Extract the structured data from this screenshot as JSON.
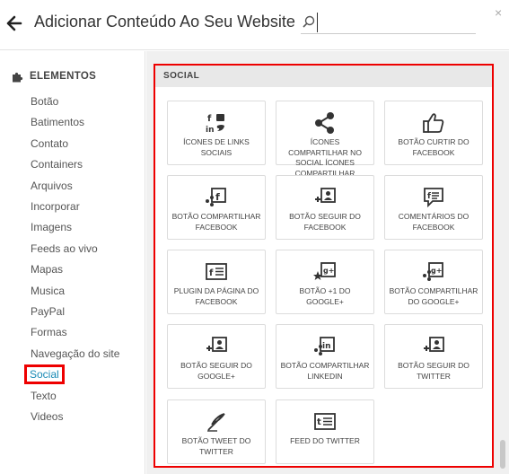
{
  "header": {
    "title": "Adicionar Conteúdo Ao Seu Website",
    "search_placeholder": "",
    "close_glyph": "×"
  },
  "sidebar": {
    "heading": "ELEMENTOS",
    "items": [
      {
        "label": "Botão"
      },
      {
        "label": "Batimentos"
      },
      {
        "label": "Contato"
      },
      {
        "label": "Containers"
      },
      {
        "label": "Arquivos"
      },
      {
        "label": "Incorporar"
      },
      {
        "label": "Imagens"
      },
      {
        "label": "Feeds ao vivo"
      },
      {
        "label": "Mapas"
      },
      {
        "label": "Musica"
      },
      {
        "label": "PayPal"
      },
      {
        "label": "Formas"
      },
      {
        "label": "Navegação do site"
      },
      {
        "label": "Social",
        "active": true
      },
      {
        "label": "Texto"
      },
      {
        "label": "Videos"
      }
    ]
  },
  "section": {
    "title": "SOCIAL"
  },
  "cards": [
    {
      "icon": "social-links-icon",
      "label": "ÍCONES DE LINKS SOCIAIS"
    },
    {
      "icon": "share-icon",
      "label": "ÍCONES COMPARTILHAR NO SOCIAL ÍCONES COMPARTILHAR SOCIAL"
    },
    {
      "icon": "thumbs-up-icon",
      "label": "BOTÃO CURTIR DO FACEBOOK"
    },
    {
      "icon": "facebook-share-icon",
      "label": "BOTÃO COMPARTILHAR FACEBOOK"
    },
    {
      "icon": "facebook-follow-icon",
      "label": "BOTÃO SEGUIR DO FACEBOOK"
    },
    {
      "icon": "facebook-comments-icon",
      "label": "COMENTÁRIOS DO FACEBOOK"
    },
    {
      "icon": "facebook-page-plugin-icon",
      "label": "PLUGIN DA PÁGINA DO FACEBOOK"
    },
    {
      "icon": "google-plus-one-icon",
      "label": "BOTÃO +1 DO GOOGLE+"
    },
    {
      "icon": "google-plus-share-icon",
      "label": "BOTÃO COMPARTILHAR DO GOOGLE+"
    },
    {
      "icon": "google-plus-follow-icon",
      "label": "BOTÃO SEGUIR DO GOOGLE+"
    },
    {
      "icon": "linkedin-share-icon",
      "label": "BOTÃO COMPARTILHAR LINKEDIN"
    },
    {
      "icon": "twitter-follow-icon",
      "label": "BOTÃO SEGUIR DO TWITTER"
    },
    {
      "icon": "twitter-tweet-icon",
      "label": "BOTÃO TWEET DO TWITTER"
    },
    {
      "icon": "twitter-feed-icon",
      "label": "FEED DO TWITTER"
    }
  ],
  "colors": {
    "accent": "#1a8ab5",
    "highlight_red": "#e00000",
    "text": "#333333"
  }
}
